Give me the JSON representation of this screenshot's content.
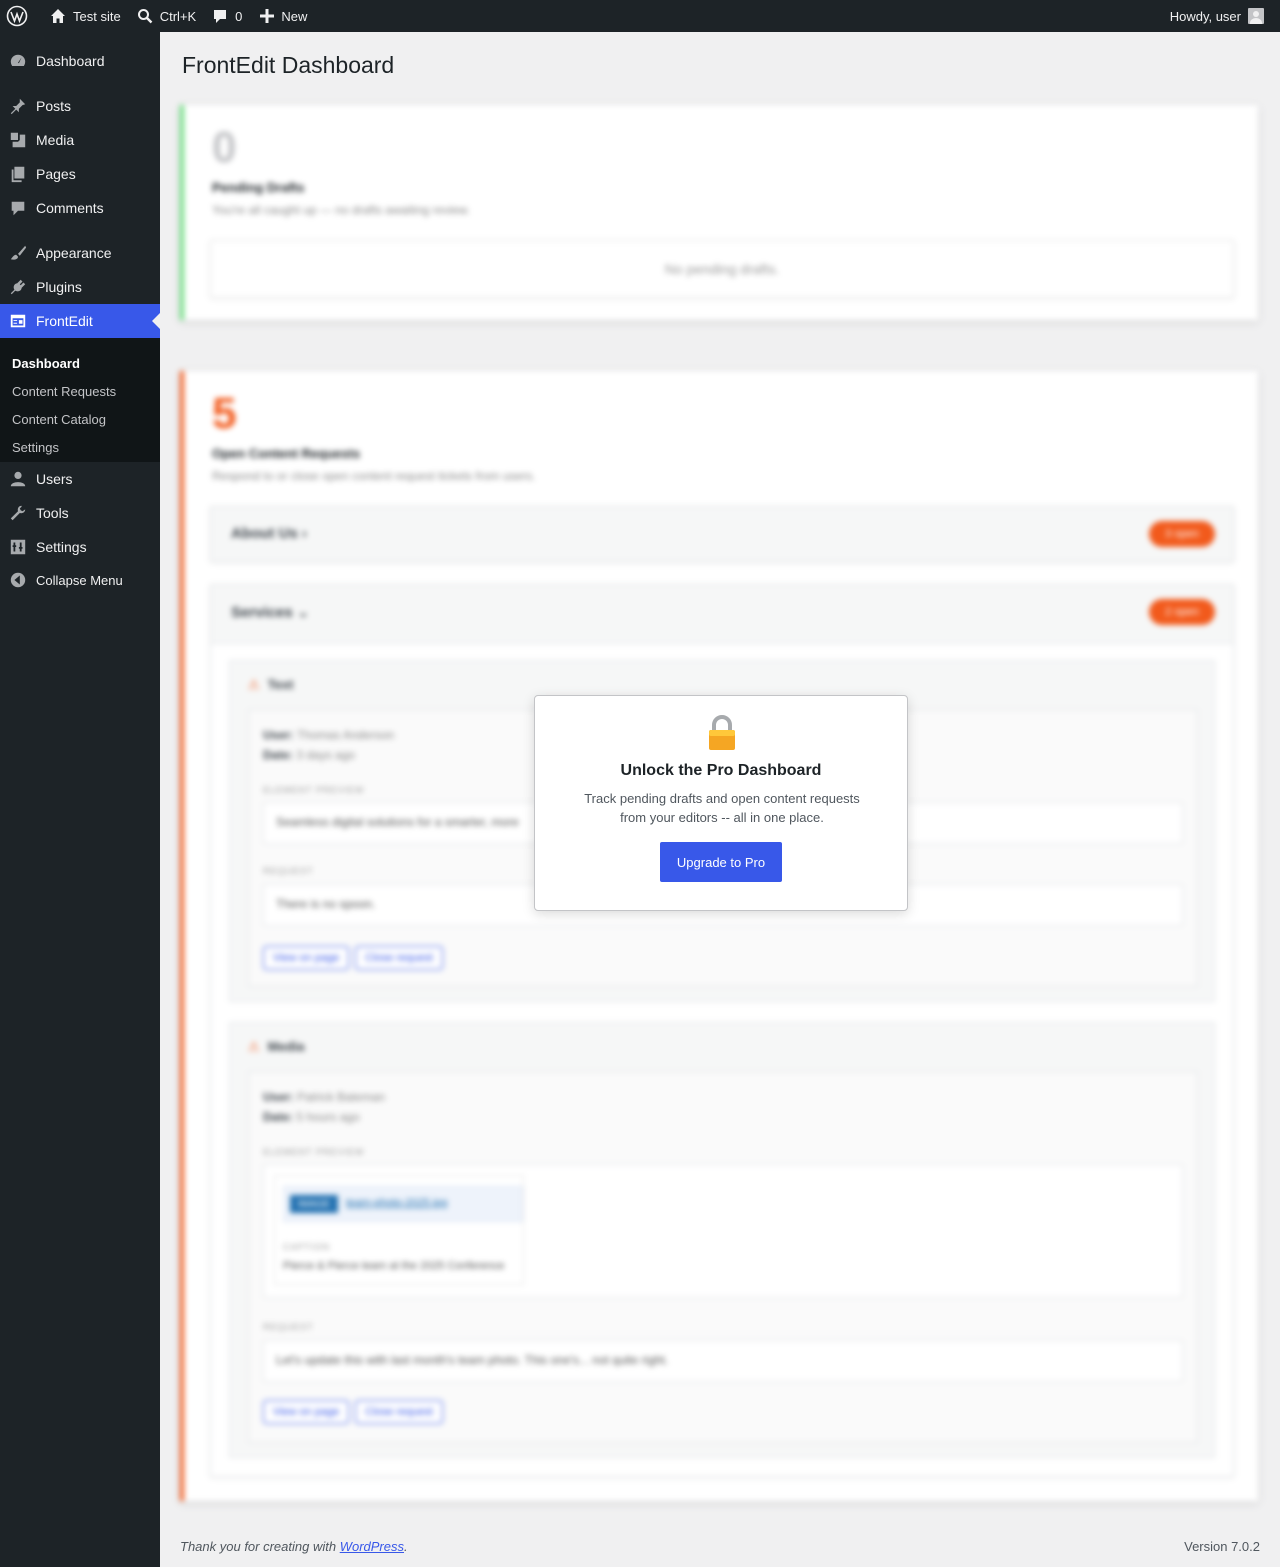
{
  "adminbar": {
    "site_name": "Test site",
    "search_shortcut": "Ctrl+K",
    "comments_count": "0",
    "new_label": "New",
    "greeting": "Howdy, user"
  },
  "sidebar": {
    "items": [
      {
        "label": "Dashboard",
        "icon": "dashboard-icon"
      },
      {
        "label": "Posts",
        "icon": "pushpin-icon"
      },
      {
        "label": "Media",
        "icon": "media-icon"
      },
      {
        "label": "Pages",
        "icon": "pages-icon"
      },
      {
        "label": "Comments",
        "icon": "comment-icon"
      },
      {
        "label": "Appearance",
        "icon": "paintbrush-icon"
      },
      {
        "label": "Plugins",
        "icon": "plugin-icon"
      },
      {
        "label": "FrontEdit",
        "icon": "frontedit-icon"
      },
      {
        "label": "Users",
        "icon": "user-icon"
      },
      {
        "label": "Tools",
        "icon": "wrench-icon"
      },
      {
        "label": "Settings",
        "icon": "settings-icon"
      },
      {
        "label": "Collapse Menu",
        "icon": "collapse-icon"
      }
    ],
    "submenu": [
      "Dashboard",
      "Content Requests",
      "Content Catalog",
      "Settings"
    ]
  },
  "page": {
    "title": "FrontEdit Dashboard"
  },
  "pending": {
    "count": "0",
    "title": "Pending Drafts",
    "desc": "You're all caught up — no drafts awaiting review.",
    "empty": "No pending drafts."
  },
  "requests": {
    "count": "5",
    "title": "Open Content Requests",
    "desc": "Respond to or close open content request tickets from users.",
    "pages": [
      {
        "name": "About Us ›",
        "badge": "3 open"
      },
      {
        "name": "Services ⌄",
        "badge": "2 open"
      }
    ],
    "items": [
      {
        "heading": "Text",
        "user_label": "User:",
        "user": "Thomas Anderson",
        "date_label": "Date:",
        "date": "3 days ago",
        "preview_label": "Element preview",
        "preview": "Seamless digital solutions for a smarter, more",
        "request_label": "Request",
        "request": "There is no spoon."
      },
      {
        "heading": "Media",
        "user_label": "User:",
        "user": "Patrick Bateman",
        "date_label": "Date:",
        "date": "5 hours ago",
        "preview_label": "Element preview",
        "chip": "IMAGE",
        "file_link": "team-photo-2025.jpg",
        "caption_label": "Caption",
        "caption": "Pierce & Pierce team at the 2025 Conference",
        "request_label": "Request",
        "request": "Let's update this with last month's team photo. This one's... not quite right."
      }
    ],
    "view_btn": "View on page",
    "close_btn": "Close request"
  },
  "modal": {
    "title": "Unlock the Pro Dashboard",
    "desc": "Track pending drafts and open content requests from your editors -- all in one place.",
    "button": "Upgrade to Pro",
    "icon": "lock-icon"
  },
  "footer": {
    "thanks_prefix": "Thank you for creating with ",
    "link": "WordPress",
    "suffix": ".",
    "version": "Version 7.0.2"
  },
  "colors": {
    "accent": "#3858e9",
    "pending_border": "#68de7c",
    "requests_accent": "#f25a1c"
  }
}
